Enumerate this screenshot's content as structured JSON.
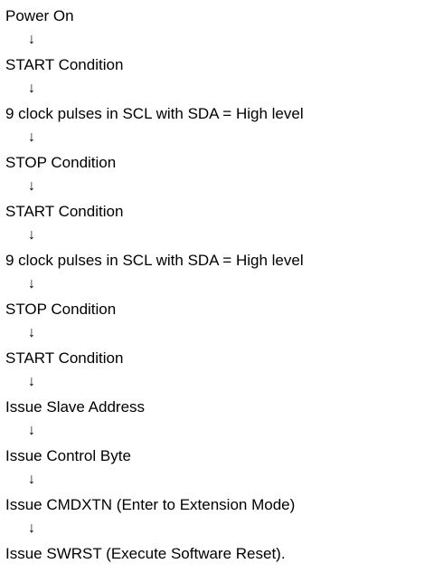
{
  "flowchart": {
    "steps": [
      "Power On",
      "START Condition",
      "9 clock pulses in SCL with SDA = High level",
      "STOP Condition",
      "START Condition",
      "9 clock pulses in SCL with SDA = High level",
      "STOP Condition",
      "START Condition",
      "Issue Slave Address",
      "Issue Control Byte",
      "Issue CMDXTN (Enter to Extension Mode)",
      "Issue SWRST (Execute Software Reset)."
    ],
    "arrow_glyph": "↓",
    "arrow_icon": "down-arrow-icon"
  }
}
